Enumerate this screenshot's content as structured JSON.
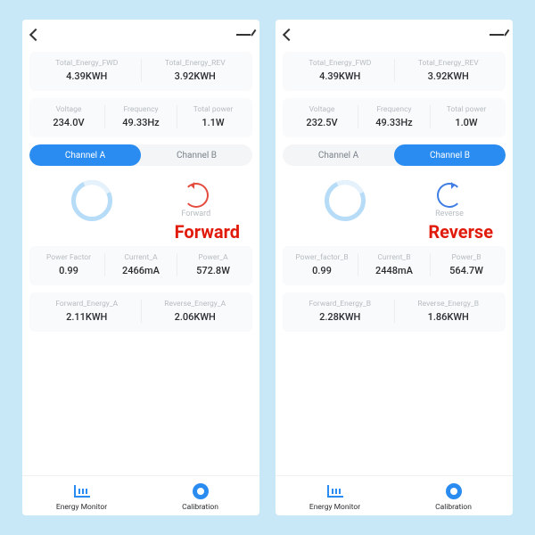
{
  "screens": [
    {
      "caption": "Forward",
      "tabs": {
        "a": "Channel A",
        "b": "Channel B",
        "active": "a"
      },
      "direction": {
        "mode": "forward",
        "label": "Forward"
      },
      "energy": {
        "fwd": {
          "label": "Total_Energy_FWD",
          "value": "4.39KWH"
        },
        "rev": {
          "label": "Total_Energy_REV",
          "value": "3.92KWH"
        }
      },
      "power": {
        "voltage": {
          "label": "Voltage",
          "value": "234.0V"
        },
        "frequency": {
          "label": "Frequency",
          "value": "49.33Hz"
        },
        "total": {
          "label": "Total power",
          "value": "1.1W"
        }
      },
      "stats1": {
        "pf": {
          "label": "Power Factor",
          "value": "0.99"
        },
        "current": {
          "label": "Current_A",
          "value": "2466mA"
        },
        "pwr": {
          "label": "Power_A",
          "value": "572.8W"
        }
      },
      "stats2": {
        "fwd": {
          "label": "Forward_Energy_A",
          "value": "2.11KWH"
        },
        "rev": {
          "label": "Reverse_Energy_A",
          "value": "2.06KWH"
        }
      },
      "nav": {
        "monitor": "Energy Monitor",
        "cal": "Calibration"
      }
    },
    {
      "caption": "Reverse",
      "tabs": {
        "a": "Channel A",
        "b": "Channel B",
        "active": "b"
      },
      "direction": {
        "mode": "reverse",
        "label": "Reverse"
      },
      "energy": {
        "fwd": {
          "label": "Total_Energy_FWD",
          "value": "4.39KWH"
        },
        "rev": {
          "label": "Total_Energy_REV",
          "value": "3.92KWH"
        }
      },
      "power": {
        "voltage": {
          "label": "Voltage",
          "value": "232.5V"
        },
        "frequency": {
          "label": "Frequency",
          "value": "49.33Hz"
        },
        "total": {
          "label": "Total power",
          "value": "1.0W"
        }
      },
      "stats1": {
        "pf": {
          "label": "Power_factor_B",
          "value": "0.99"
        },
        "current": {
          "label": "Current_B",
          "value": "2448mA"
        },
        "pwr": {
          "label": "Power_B",
          "value": "564.7W"
        }
      },
      "stats2": {
        "fwd": {
          "label": "Forward_Energy_B",
          "value": "2.28KWH"
        },
        "rev": {
          "label": "Reverse_Energy_B",
          "value": "1.86KWH"
        }
      },
      "nav": {
        "monitor": "Energy Monitor",
        "cal": "Calibration"
      }
    }
  ]
}
